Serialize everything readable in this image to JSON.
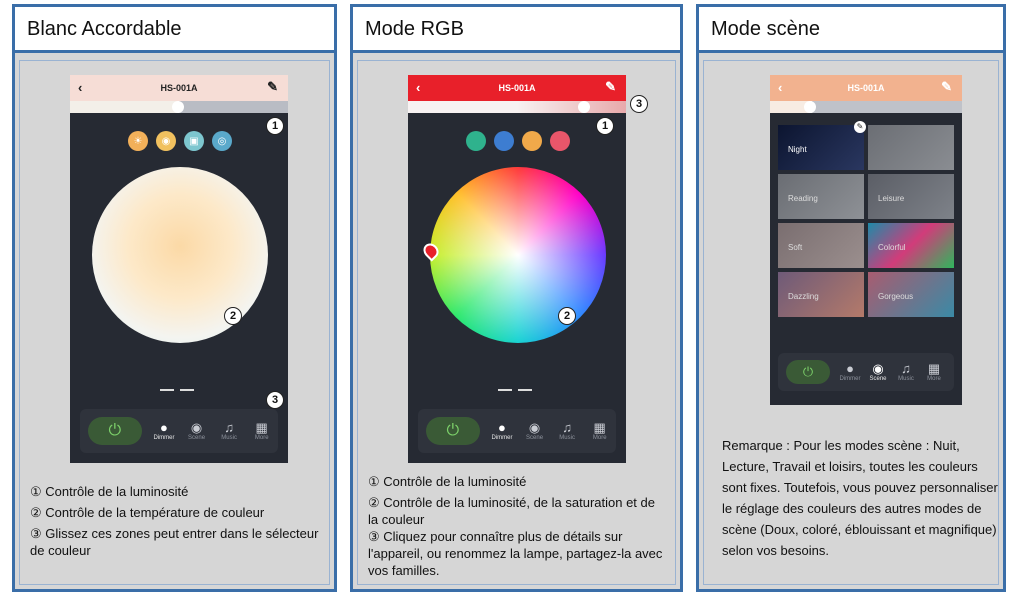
{
  "panels": [
    {
      "title": "Blanc Accordable",
      "device": "HS-001A",
      "nav": [
        "Dimmer",
        "Scene",
        "Music",
        "More"
      ],
      "captions": [
        "① Contrôle de la luminosité",
        "② Contrôle de la température de couleur",
        "③ Glissez ces zones peut entrer dans le sélecteur de couleur"
      ],
      "markers": [
        "1",
        "2",
        "3"
      ]
    },
    {
      "title": "Mode RGB",
      "device": "HS-001A",
      "nav": [
        "Dimmer",
        "Scene",
        "Music",
        "More"
      ],
      "captions": [
        "① Contrôle de la luminosité",
        "② Contrôle de la luminosité, de la saturation et de la couleur",
        "③ Cliquez pour connaître plus de détails sur l'appareil, ou renommez la lampe, partagez-la avec vos familles."
      ],
      "markers": [
        "1",
        "2",
        "3"
      ]
    },
    {
      "title": "Mode scène",
      "device": "HS-001A",
      "nav": [
        "Dimmer",
        "Scene",
        "Music",
        "More"
      ],
      "scenes": [
        "Night",
        "",
        "Reading",
        "Leisure",
        "Soft",
        "Colorful",
        "Dazzling",
        "Gorgeous"
      ],
      "remark": "Remarque : Pour les modes scène : Nuit, Lecture, Travail et loisirs, toutes les couleurs sont fixes. Toutefois, vous pouvez personnaliser le réglage des couleurs des autres modes de scène (Doux, coloré, éblouissant et magnifique) selon vos besoins."
    }
  ],
  "colors": {
    "border": "#3a6ea8",
    "warm_header": "#f6ddd6",
    "rgb_header": "#e8202a",
    "scene_header": "#f2b28f",
    "power_green": "#7cd06a"
  },
  "icons": [
    "back-arrow-icon",
    "edit-pencil-icon",
    "power-icon",
    "bulb-icon",
    "scene-icon",
    "music-icon",
    "grid-icon",
    "pointing-hand-icon"
  ]
}
